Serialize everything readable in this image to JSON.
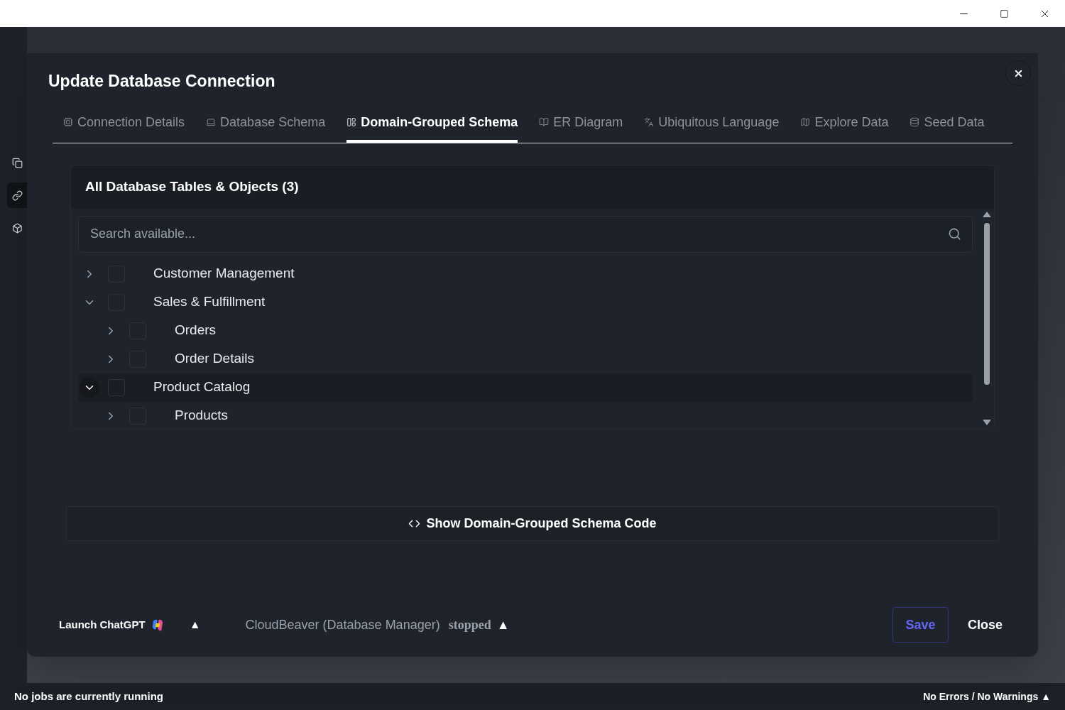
{
  "dialog": {
    "title": "Update Database Connection",
    "tabs": [
      {
        "label": "Connection Details",
        "selected": false
      },
      {
        "label": "Database Schema",
        "selected": false
      },
      {
        "label": "Domain-Grouped Schema",
        "selected": true
      },
      {
        "label": "ER Diagram",
        "selected": false
      },
      {
        "label": "Ubiquitous Language",
        "selected": false
      },
      {
        "label": "Explore Data",
        "selected": false
      },
      {
        "label": "Seed Data",
        "selected": false
      }
    ],
    "panel": {
      "title": "All Database Tables & Objects (3)",
      "search": {
        "placeholder": "Search available..."
      },
      "tree": [
        {
          "label": "Customer Management",
          "expanded": false,
          "checked": false,
          "selected": false
        },
        {
          "label": "Sales & Fulfillment",
          "expanded": true,
          "checked": false,
          "selected": false,
          "children": [
            {
              "label": "Orders",
              "expanded": false,
              "checked": false,
              "selected": false
            },
            {
              "label": "Order Details",
              "expanded": false,
              "checked": false,
              "selected": false
            }
          ]
        },
        {
          "label": "Product Catalog",
          "expanded": true,
          "checked": false,
          "selected": true,
          "children": [
            {
              "label": "Products",
              "expanded": false,
              "checked": false,
              "selected": false
            }
          ]
        }
      ]
    },
    "code_button": "Show Domain-Grouped Schema Code",
    "footer": {
      "chatgpt": "Launch ChatGPT",
      "chatgpt_caret": "▲",
      "service": "CloudBeaver (Database Manager)",
      "service_status": "stopped",
      "service_caret": "▲",
      "save": "Save",
      "close": "Close"
    }
  },
  "status_bar": {
    "jobs": "No jobs are currently running",
    "problems": "No Errors / No Warnings ▲"
  }
}
